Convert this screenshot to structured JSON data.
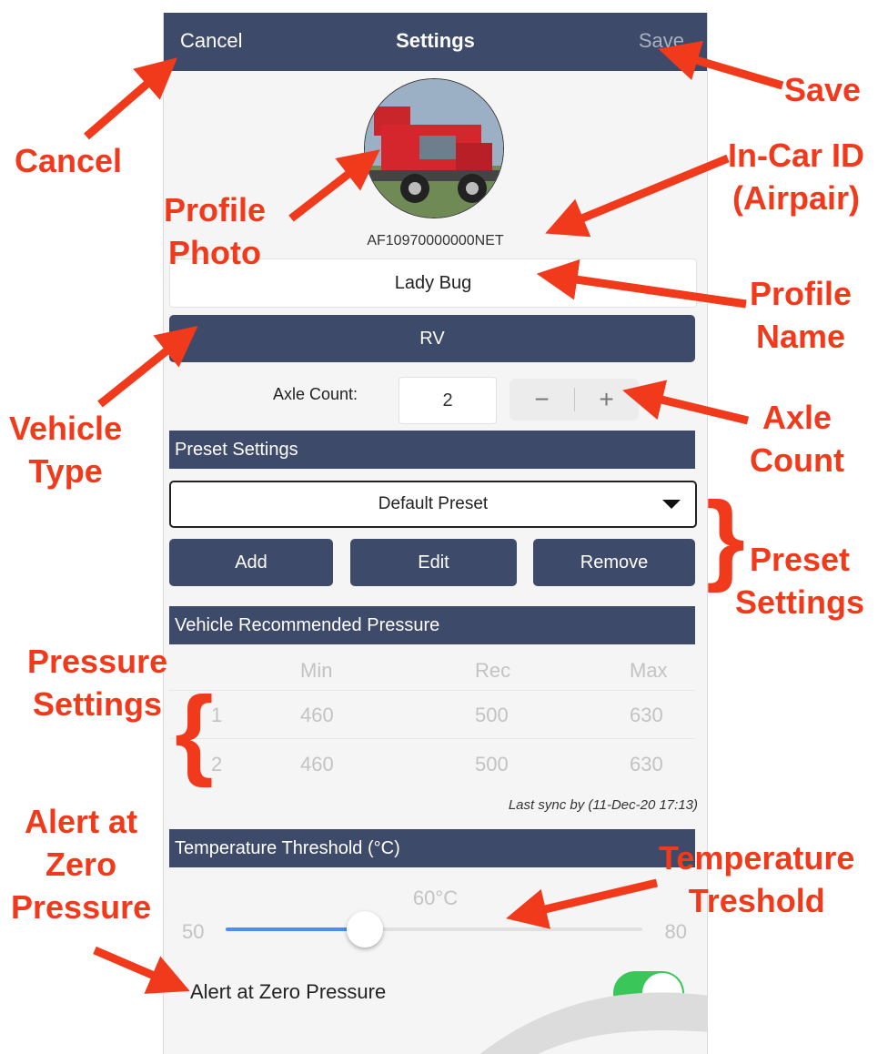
{
  "navbar": {
    "cancel": "Cancel",
    "title": "Settings",
    "save": "Save"
  },
  "profile": {
    "device_id": "AF10970000000NET",
    "name": "Lady Bug",
    "vehicle_type": "RV"
  },
  "axle": {
    "label": "Axle Count:",
    "value": "2",
    "minus": "−",
    "plus": "+"
  },
  "preset": {
    "header": "Preset Settings",
    "selected": "Default Preset",
    "add": "Add",
    "edit": "Edit",
    "remove": "Remove"
  },
  "pressure": {
    "header": "Vehicle Recommended Pressure",
    "columns": [
      "Min",
      "Rec",
      "Max"
    ],
    "rows": [
      {
        "axle": "1",
        "min": "460",
        "rec": "500",
        "max": "630"
      },
      {
        "axle": "2",
        "min": "460",
        "rec": "500",
        "max": "630"
      }
    ],
    "last_sync": "Last sync by (11-Dec-20 17:13)"
  },
  "temperature": {
    "header": "Temperature Threshold (°C)",
    "value_label": "60°C",
    "min_label": "50",
    "max_label": "80",
    "fraction": 0.333
  },
  "alert": {
    "label": "Alert at Zero Pressure",
    "enabled": true
  },
  "colors": {
    "navbar": "#3e4a69",
    "annotation": "#f03a1b",
    "toggle_on": "#3ac659",
    "slider": "#4e8cf3"
  },
  "annotations": {
    "save": "Save",
    "cancel": "Cancel",
    "incar_id": [
      "In-Car ID",
      "(Airpair)"
    ],
    "profile_photo": [
      "Profile",
      "Photo"
    ],
    "profile_name": [
      "Profile",
      "Name"
    ],
    "vehicle_type": [
      "Vehicle",
      "Type"
    ],
    "axle_count": [
      "Axle",
      "Count"
    ],
    "preset_settings": [
      "Preset",
      "Settings"
    ],
    "pressure_settings": [
      "Pressure",
      "Settings"
    ],
    "alert_zero": [
      "Alert at",
      "Zero",
      "Pressure"
    ],
    "temperature": [
      "Temperature",
      "Treshold"
    ]
  }
}
